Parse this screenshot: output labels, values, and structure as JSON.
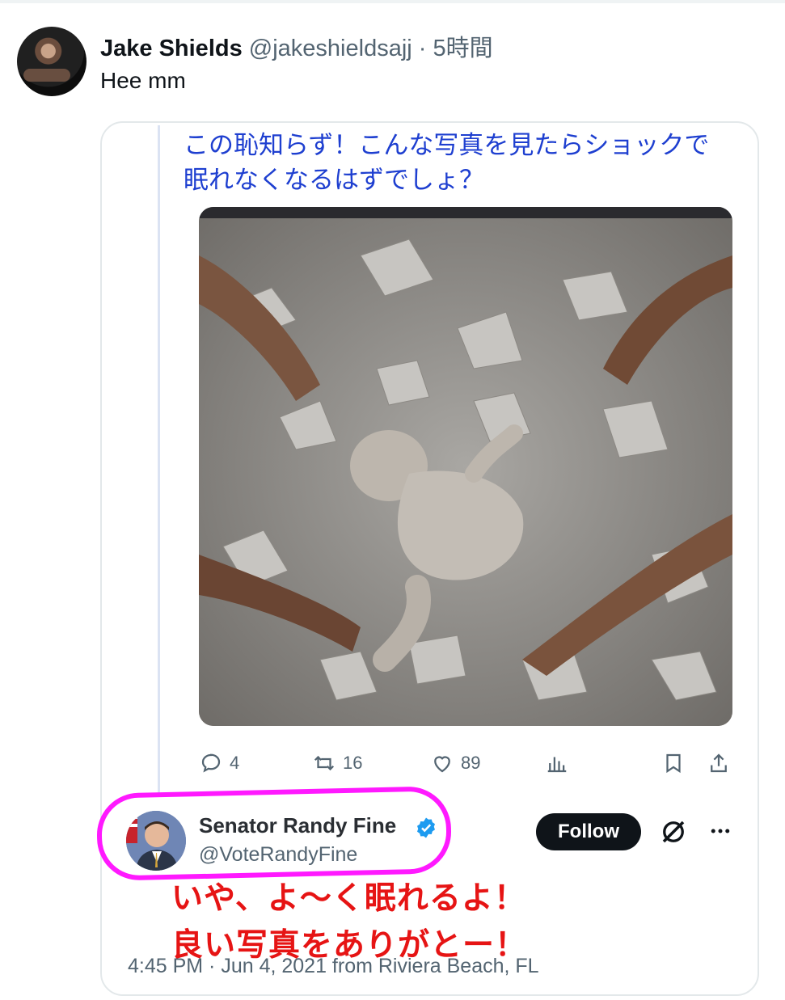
{
  "tweet": {
    "author_name": "Jake Shields",
    "author_handle": "@jakeshieldsajj",
    "separator": "·",
    "time": "5時間",
    "text": "Hee mm"
  },
  "quote": {
    "comment_line1": "この恥知らず！こんな写真を見たらショックで",
    "comment_line2": "眠れなくなるはずでしょ？",
    "actions": {
      "reply_count": "4",
      "retweet_count": "16",
      "like_count": "89"
    },
    "embedded": {
      "name": "Senator Randy Fine",
      "handle": "@VoteRandyFine",
      "follow_label": "Follow",
      "reply_line1": "いや、よ〜く眠れるよ！",
      "reply_line2": "良い写真をありがとー！",
      "timestamp": "4:45 PM · Jun 4, 2021 from Riviera Beach, FL"
    }
  },
  "colors": {
    "comment_text": "#1e3fd0",
    "highlight_ring": "#ff19ff",
    "overlay_text": "#e61414",
    "verified": "#1d9bf0",
    "secondary_text": "#536471"
  },
  "icons": [
    "reply-icon",
    "retweet-icon",
    "like-icon",
    "views-icon",
    "bookmark-icon",
    "share-icon",
    "verified-icon",
    "grok-icon",
    "more-icon"
  ]
}
